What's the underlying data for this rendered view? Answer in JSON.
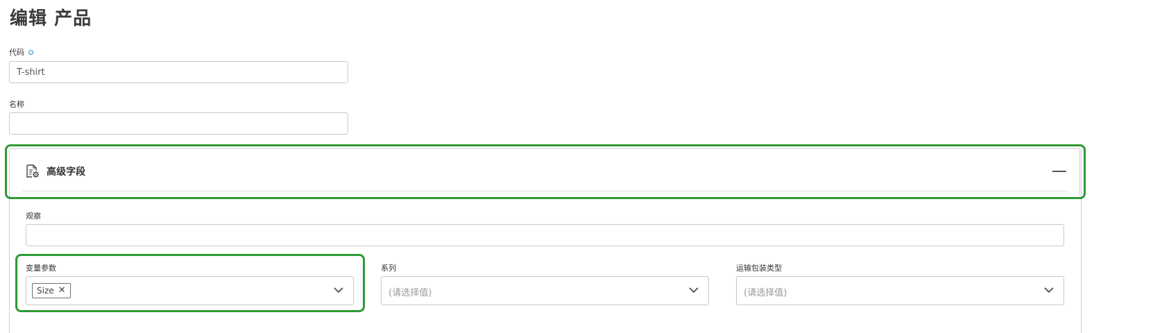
{
  "page": {
    "title": "编辑 产品"
  },
  "form": {
    "code": {
      "label": "代码",
      "value": "T-shirt"
    },
    "name": {
      "label": "名称",
      "value": ""
    }
  },
  "advanced": {
    "title": "高级字段",
    "icon": "document-gear-icon",
    "observation": {
      "label": "观察",
      "value": ""
    },
    "variant_params": {
      "label": "变量参数",
      "tags": [
        "Size"
      ]
    },
    "series": {
      "label": "系列",
      "placeholder": "(请选择值)"
    },
    "shipping_package_type": {
      "label": "运输包装类型",
      "placeholder": "(请选择值)"
    }
  },
  "colors": {
    "highlight": "#2e9a34",
    "required_dot": "#1a8fd8"
  }
}
